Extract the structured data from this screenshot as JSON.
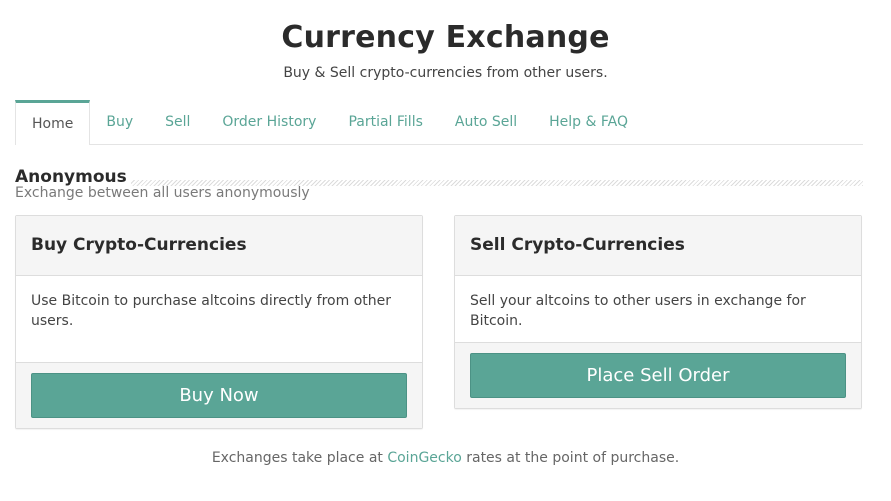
{
  "header": {
    "title": "Currency Exchange",
    "subtitle": "Buy & Sell crypto-currencies from other users."
  },
  "tabs": [
    {
      "label": "Home",
      "active": true
    },
    {
      "label": "Buy",
      "active": false
    },
    {
      "label": "Sell",
      "active": false
    },
    {
      "label": "Order History",
      "active": false
    },
    {
      "label": "Partial Fills",
      "active": false
    },
    {
      "label": "Auto Sell",
      "active": false
    },
    {
      "label": "Help & FAQ",
      "active": false
    }
  ],
  "section": {
    "title": "Anonymous",
    "description": "Exchange between all users anonymously"
  },
  "buy_card": {
    "title": "Buy Crypto-Currencies",
    "body": "Use Bitcoin to purchase altcoins directly from other users.",
    "button": "Buy Now"
  },
  "sell_card": {
    "title": "Sell Crypto-Currencies",
    "body": "Sell your altcoins to other users in exchange for Bitcoin.",
    "button": "Place Sell Order"
  },
  "footer": {
    "prefix": "Exchanges take place at ",
    "link": "CoinGecko",
    "suffix": " rates at the point of purchase."
  },
  "colors": {
    "accent": "#5aa596",
    "card_header_bg": "#f5f5f5",
    "border": "#dddddd"
  }
}
